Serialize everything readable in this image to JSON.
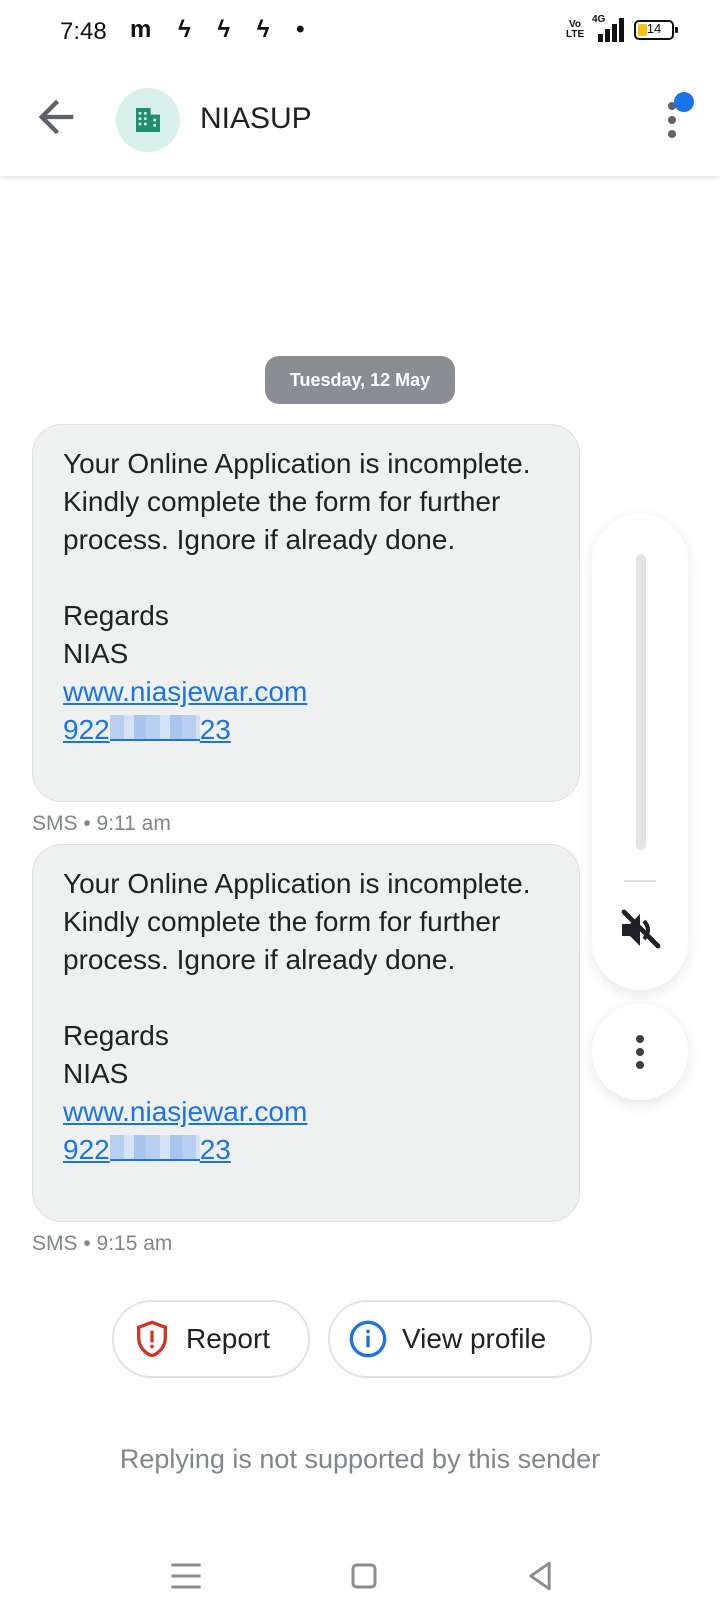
{
  "status": {
    "time": "7:48",
    "left_icons": "m ϟ ϟ ϟ •",
    "volte": "Vo LTE",
    "network": "4G",
    "battery": "14"
  },
  "header": {
    "contact_name": "NIASUP",
    "avatar_icon": "building-icon"
  },
  "date_chip": "Tuesday, 12 May",
  "messages": [
    {
      "body": "Your Online Application is incomplete. Kindly complete the form for further process. Ignore if already done.",
      "regards": "Regards",
      "sender": "NIAS",
      "link": "www.niasjewar.com",
      "phone_prefix": "922",
      "phone_suffix": "23",
      "meta": "SMS • 9:11 am"
    },
    {
      "body": "Your Online Application is incomplete. Kindly complete the form for further process. Ignore if already done.",
      "regards": "Regards",
      "sender": "NIAS",
      "link": "www.niasjewar.com",
      "phone_prefix": "922",
      "phone_suffix": "23",
      "meta": "SMS • 9:15 am"
    }
  ],
  "actions": {
    "report_label": "Report",
    "view_profile_label": "View profile"
  },
  "reply_note": "Replying is not supported by this sender",
  "colors": {
    "accent": "#1a73e8",
    "report": "#d93025",
    "bubble": "#eff1f1",
    "avatar_bg": "#d7f0ea",
    "avatar_fg": "#1e8e6e"
  }
}
